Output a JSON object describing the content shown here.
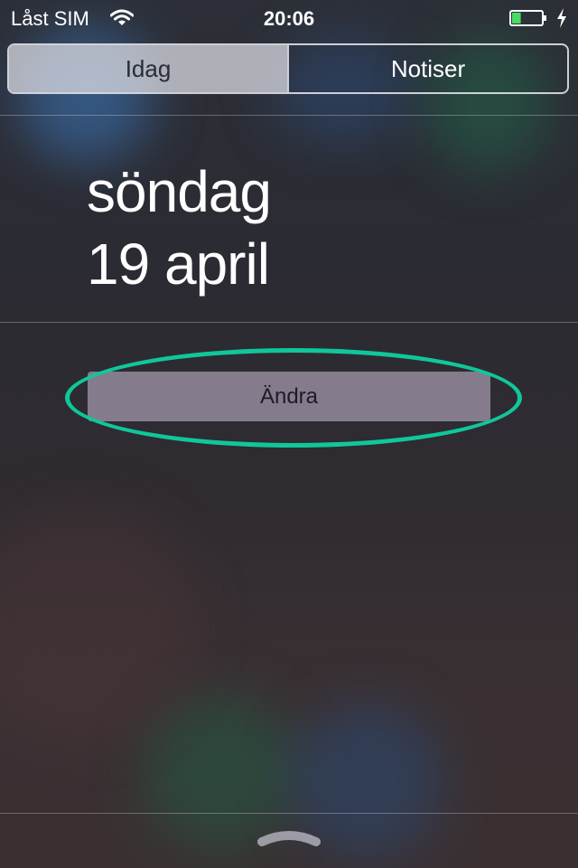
{
  "status_bar": {
    "carrier": "Låst SIM",
    "time": "20:06",
    "wifi_icon": "wifi-icon",
    "battery_icon": "battery-icon",
    "charging_icon": "charging-bolt-icon",
    "battery_level": 0.3,
    "battery_color": "#4cd964"
  },
  "tabs": [
    {
      "label": "Idag",
      "selected": true
    },
    {
      "label": "Notiser",
      "selected": false
    }
  ],
  "today": {
    "weekday": "söndag",
    "date": "19 april"
  },
  "edit_button": {
    "label": "Ändra"
  },
  "annotation": {
    "color": "#10c79a"
  },
  "grabber_icon": "chevron-up-handle-icon"
}
